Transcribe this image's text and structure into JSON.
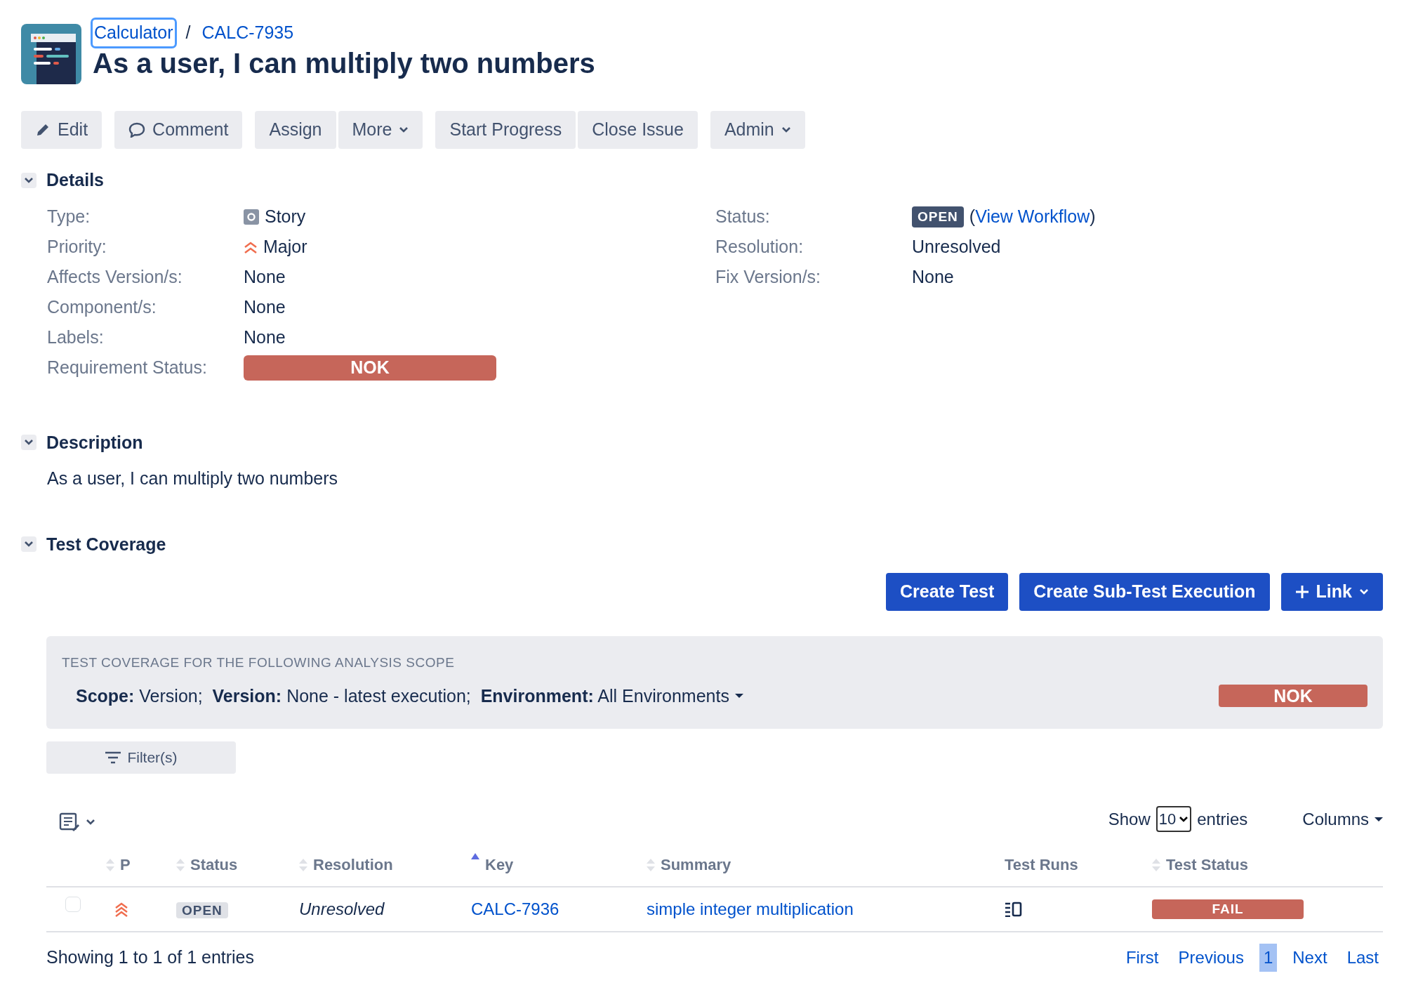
{
  "breadcrumbs": [
    {
      "label": "Calculator",
      "focused": true
    },
    {
      "label": "CALC-7935",
      "focused": false
    }
  ],
  "separator": "/",
  "title": "As a user, I can multiply two numbers",
  "toolbar": [
    {
      "label": "Edit",
      "dropdown": false
    },
    {
      "label": "Comment",
      "dropdown": false
    },
    {
      "label": "Assign",
      "dropdown": false
    },
    {
      "label": "More",
      "dropdown": true
    },
    {
      "label": "Start Progress",
      "dropdown": false
    },
    {
      "label": "Close Issue",
      "dropdown": false
    },
    {
      "label": "Admin",
      "dropdown": true
    }
  ],
  "details": {
    "heading": "Details",
    "expanded": true,
    "left": [
      {
        "label": "Type:",
        "value": "Story",
        "kind": "story"
      },
      {
        "label": "Priority:",
        "value": "Major",
        "kind": "priority"
      },
      {
        "label": "Affects Version/s:",
        "value": "None",
        "kind": "text"
      },
      {
        "label": "Component/s:",
        "value": "None",
        "kind": "text"
      },
      {
        "label": "Labels:",
        "value": "None",
        "kind": "text"
      },
      {
        "label": "Requirement Status:",
        "value": "NOK",
        "kind": "bar"
      }
    ],
    "right": [
      {
        "label": "Status:",
        "value": "OPEN",
        "kind": "status",
        "link_prefix": "(",
        "link": "View Workflow",
        "link_suffix": ")"
      },
      {
        "label": "Resolution:",
        "value": "Unresolved",
        "kind": "text"
      },
      {
        "label": "Fix Version/s:",
        "value": "None",
        "kind": "text"
      }
    ]
  },
  "description": {
    "heading": "Description",
    "expanded": true,
    "text": "As a user, I can multiply two numbers"
  },
  "test_coverage": {
    "heading": "Test Coverage",
    "expanded": true,
    "actions": [
      {
        "label": "Create Test",
        "dropdown": false
      },
      {
        "label": "Create Sub-Test Execution",
        "dropdown": false
      },
      {
        "label": "Link",
        "dropdown": true
      }
    ],
    "scope_title": "TEST COVERAGE FOR THE FOLLOWING ANALYSIS SCOPE",
    "scope_text": "**Scope:** Version;  **Version:** None - latest execution;  **Environment:** All Environments",
    "scope_status": "NOK",
    "filter_button": "Filter(s)",
    "show_label": "Show",
    "page_size": "10",
    "entries_label": "entries",
    "columns_button": "Columns",
    "table": {
      "columns": [
        {
          "label": "P",
          "sorted": false
        },
        {
          "label": "Status",
          "sorted": false
        },
        {
          "label": "Resolution",
          "sorted": false
        },
        {
          "label": "Key",
          "sorted": true
        },
        {
          "label": "Summary",
          "sorted": false
        },
        {
          "label": "Test Runs"
        },
        {
          "label": "Test Status",
          "sorted": false
        }
      ],
      "rows": [
        {
          "checked": false,
          "status": "OPEN",
          "resolution": "Unresolved",
          "key": "CALC-7936",
          "summary": "simple integer multiplication",
          "test_status": "FAIL"
        }
      ]
    },
    "info": "Showing 1 to 1 of 1 entries",
    "pagination": [
      {
        "label": "First",
        "selected": false
      },
      {
        "label": "Previous",
        "selected": false
      },
      {
        "label": "1",
        "selected": true
      },
      {
        "label": "Next",
        "selected": false
      },
      {
        "label": "Last",
        "selected": false
      }
    ]
  }
}
